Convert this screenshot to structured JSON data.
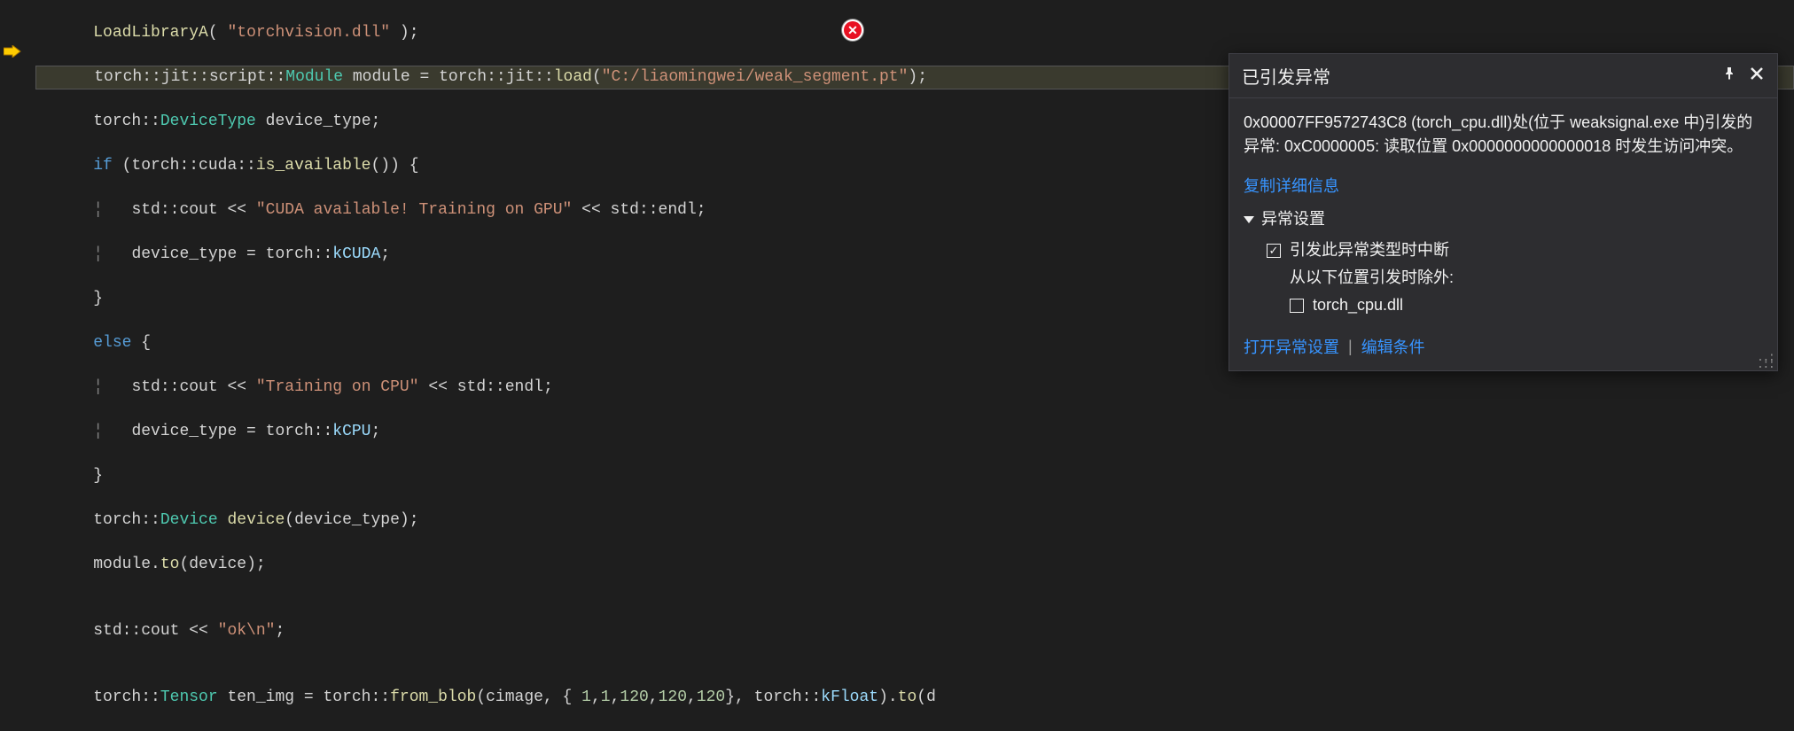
{
  "code": {
    "l1a": "LoadLibraryA",
    "l1b": "(",
    "l1c": "\"torchvision.dll\"",
    "l1d": ");",
    "l2a": "torch::jit::script::",
    "l2b": "Module",
    "l2c": " module = torch::jit::",
    "l2d": "load",
    "l2e": "(",
    "l2f": "\"C:/liaomingwei/weak_segment.pt\"",
    "l2g": ");",
    "l3a": "torch::",
    "l3b": "DeviceType",
    "l3c": " device_type;",
    "l4a": "if",
    "l4b": " (torch::cuda::",
    "l4c": "is_available",
    "l4d": "()) {",
    "l5a": "std::cout << ",
    "l5b": "\"CUDA available! Training on GPU\"",
    "l5c": " << std::endl;",
    "l6a": "device_type = torch::",
    "l6b": "kCUDA",
    "l6c": ";",
    "l7a": "}",
    "l8a": "else",
    "l8b": " {",
    "l9a": "std::cout << ",
    "l9b": "\"Training on CPU\"",
    "l9c": " << std::endl;",
    "l10a": "device_type = torch::",
    "l10b": "kCPU",
    "l10c": ";",
    "l11a": "}",
    "l12a": "torch::",
    "l12b": "Device",
    "l12c": " ",
    "l12d": "device",
    "l12e": "(device_type);",
    "l13a": "module.",
    "l13b": "to",
    "l13c": "(device);",
    "l14a": "",
    "l15a": "std::cout << ",
    "l15b": "\"ok\\n\"",
    "l15c": ";",
    "l16a": "",
    "l17a": "torch::",
    "l17b": "Tensor",
    "l17c": " ten_img = torch::",
    "l17d": "from_blob",
    "l17e": "(cimage, { ",
    "l17f": "1",
    "l17g": ",",
    "l17h": "1",
    "l17i": ",",
    "l17j": "120",
    "l17k": ",",
    "l17l": "120",
    "l17m": ",",
    "l17n": "120",
    "l17o": "}, torch::",
    "l17p": "kFloat",
    "l17q": ").",
    "l17r": "to",
    "l17s": "(d"
  },
  "error_glyph": "✕",
  "popup": {
    "title": "已引发异常",
    "message": "0x00007FF9572743C8 (torch_cpu.dll)处(位于 weaksignal.exe 中)引发的异常: 0xC0000005: 读取位置 0x0000000000000018 时发生访问冲突。",
    "copy_details": "复制详细信息",
    "settings_header": "异常设置",
    "break_on_type": "引发此异常类型时中断",
    "except_from": "从以下位置引发时除外:",
    "except_module": "torch_cpu.dll",
    "open_settings": "打开异常设置",
    "edit_conditions": "编辑条件",
    "checkbox_checked": "✓",
    "divider": "|"
  }
}
